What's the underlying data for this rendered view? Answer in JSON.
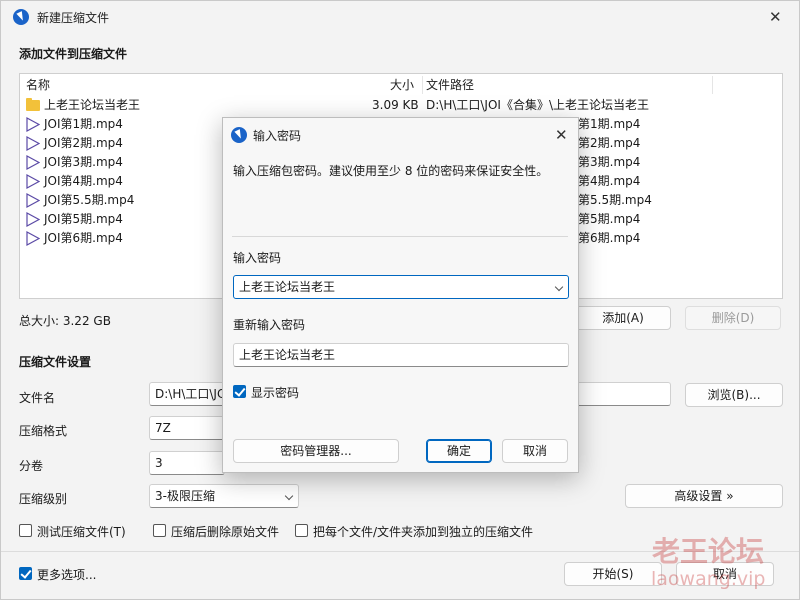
{
  "main_window": {
    "title": "新建压缩文件",
    "section_add": "添加文件到压缩文件",
    "list": {
      "headers": {
        "name": "名称",
        "size": "大小",
        "path": "文件路径"
      },
      "rows": [
        {
          "icon": "folder-icon",
          "name": "上老王论坛当老王",
          "size": "3.09 KB",
          "path": "D:\\H\\工口\\JOI《合集》\\上老王论坛当老王"
        },
        {
          "icon": "video-file-icon",
          "name": "JOI第1期.mp4",
          "size": "",
          "path": "第1期.mp4"
        },
        {
          "icon": "video-file-icon",
          "name": "JOI第2期.mp4",
          "size": "",
          "path": "第2期.mp4"
        },
        {
          "icon": "video-file-icon",
          "name": "JOI第3期.mp4",
          "size": "",
          "path": "第3期.mp4"
        },
        {
          "icon": "video-file-icon",
          "name": "JOI第4期.mp4",
          "size": "",
          "path": "第4期.mp4"
        },
        {
          "icon": "video-file-icon",
          "name": "JOI第5.5期.mp4",
          "size": "",
          "path": "第5.5期.mp4"
        },
        {
          "icon": "video-file-icon",
          "name": "JOI第5期.mp4",
          "size": "",
          "path": "第5期.mp4"
        },
        {
          "icon": "video-file-icon",
          "name": "JOI第6期.mp4",
          "size": "",
          "path": "第6期.mp4"
        }
      ]
    },
    "total_size": "总大小: 3.22 GB",
    "add_button": "添加(A)",
    "delete_button": "删除(D)",
    "section_settings": "压缩文件设置",
    "filename_label": "文件名",
    "filename_value": "D:\\H\\工口\\JC",
    "browse_button": "浏览(B)...",
    "format_label": "压缩格式",
    "format_value": "7Z",
    "volume_label": "分卷",
    "volume_value": "3",
    "level_label": "压缩级别",
    "level_value": "3-极限压缩",
    "advanced_button": "高级设置 »",
    "test_checkbox": "测试压缩文件(T)",
    "delete_after_checkbox": "压缩后删除原始文件",
    "separate_checkbox": "把每个文件/文件夹添加到独立的压缩文件",
    "more_options": "更多选项...",
    "start_button": "开始(S)",
    "cancel_button": "取消"
  },
  "password_dialog": {
    "title": "输入密码",
    "hint": "输入压缩包密码。建议使用至少 8 位的密码来保证安全性。",
    "password_label": "输入密码",
    "password_value": "上老王论坛当老王",
    "reenter_label": "重新输入密码",
    "reenter_value": "上老王论坛当老王",
    "show_password": "显示密码",
    "manager_button": "密码管理器...",
    "ok_button": "确定",
    "cancel_button": "取消"
  },
  "watermark": {
    "text": "老王论坛",
    "url": "laowang.vip"
  }
}
